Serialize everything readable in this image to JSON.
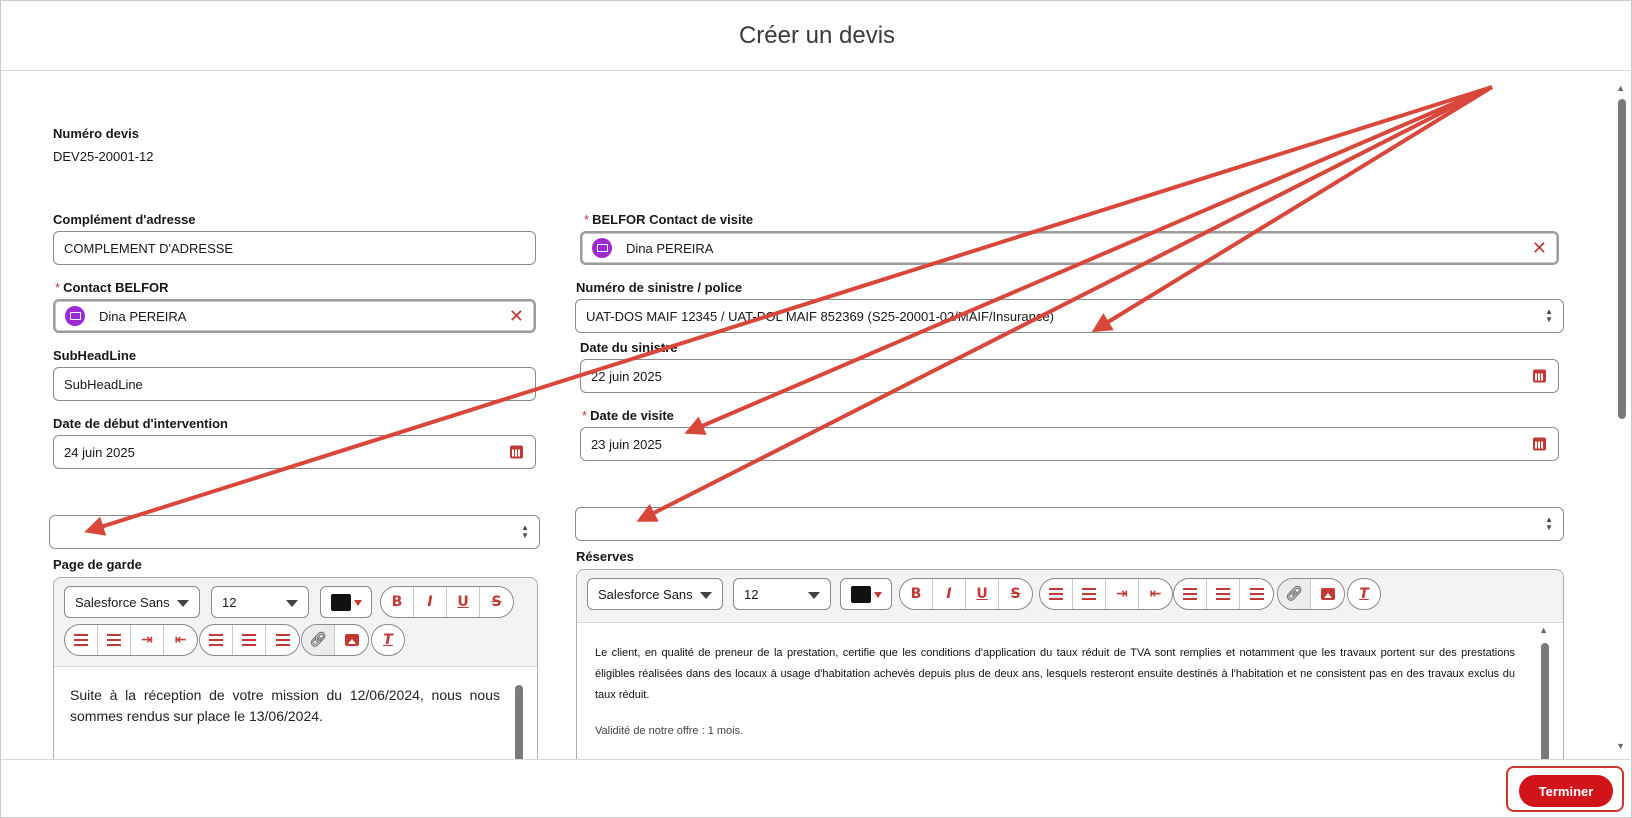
{
  "modal": {
    "title": "Créer un devis"
  },
  "quote_number": {
    "label": "Numéro devis",
    "value": "DEV25-20001-12"
  },
  "left": {
    "address_complement": {
      "label": "Complément d'adresse",
      "value": "COMPLEMENT D'ADRESSE"
    },
    "belfor_contact": {
      "required": "*",
      "label": "Contact BELFOR",
      "value": "Dina PEREIRA"
    },
    "subheadline": {
      "label": "SubHeadLine",
      "value": "SubHeadLine"
    },
    "intervention_start": {
      "label": "Date de début d'intervention",
      "value": "24 juin 2025"
    },
    "empty_select": {
      "value": ""
    },
    "cover_page": {
      "label": "Page de garde",
      "font": "Salesforce Sans",
      "size": "12",
      "text": "Suite à la réception de votre mission du 12/06/2024, nous nous sommes rendus sur place le 13/06/2024."
    }
  },
  "right": {
    "visit_contact": {
      "required": "*",
      "label": "BELFOR Contact de visite",
      "value": "Dina PEREIRA"
    },
    "claim_policy": {
      "label": "Numéro de sinistre / police",
      "value": "UAT-DOS MAIF 12345 / UAT-POL MAIF 852369 (S25-20001-02/MAIF/Insurance)"
    },
    "claim_date": {
      "label": "Date du sinistre",
      "value": "22 juin 2025"
    },
    "visit_date": {
      "required": "*",
      "label": "Date de visite",
      "value": "23 juin 2025"
    },
    "empty_select": {
      "value": ""
    },
    "reserves": {
      "label": "Réserves",
      "font": "Salesforce Sans",
      "size": "12",
      "text": "Le client, en qualité de preneur de la prestation, certifie que les conditions d'application du taux réduit de TVA sont remplies et notamment que les travaux portent sur des prestations éligibles réalisées dans des locaux à usage d'habitation achevés depuis plus de deux ans, lesquels resteront ensuite destinés à l'habitation et ne consistent pas en des travaux exclus du taux réduit.",
      "validity": "Validité de notre offre : 1 mois."
    }
  },
  "toolbar": {
    "bold": "B",
    "italic": "I",
    "underline": "U",
    "strike": "S",
    "clear_format": "T"
  },
  "footer": {
    "finish_label": "Terminer"
  },
  "colors": {
    "accent": "#d0141a",
    "annotation": "#d9473b",
    "avatar": "#9b2ad1"
  }
}
